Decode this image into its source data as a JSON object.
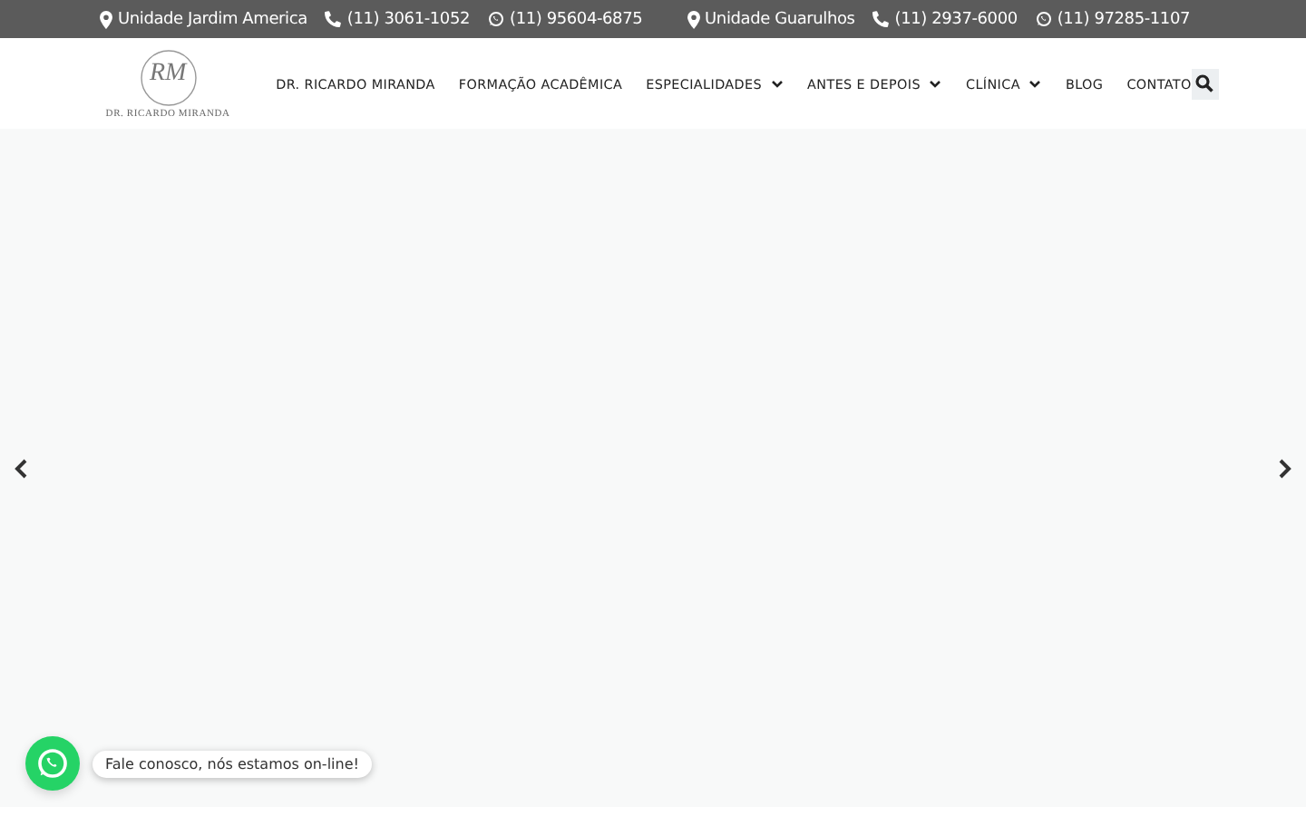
{
  "top_bar": {
    "locations": [
      {
        "unit": "Unidade Jardim America",
        "phone": "(11) 3061-1052",
        "whatsapp": "(11) 95604-6875"
      },
      {
        "unit": "Unidade Guarulhos",
        "phone": "(11) 2937-6000",
        "whatsapp": "(11) 97285-1107"
      }
    ]
  },
  "header": {
    "logo": {
      "monogram": "RM",
      "name": "DR. RICARDO MIRANDA"
    },
    "nav": [
      {
        "label": "DR. RICARDO MIRANDA",
        "has_dropdown": false
      },
      {
        "label": "FORMAÇÃO ACADÊMICA",
        "has_dropdown": false
      },
      {
        "label": "ESPECIALIDADES",
        "has_dropdown": true
      },
      {
        "label": "ANTES E DEPOIS",
        "has_dropdown": true
      },
      {
        "label": "CLÍNICA",
        "has_dropdown": true
      },
      {
        "label": "BLOG",
        "has_dropdown": false
      },
      {
        "label": "CONTATO",
        "has_dropdown": false
      }
    ]
  },
  "chat_widget": {
    "message": "Fale conosco, nós estamos on-line!"
  }
}
